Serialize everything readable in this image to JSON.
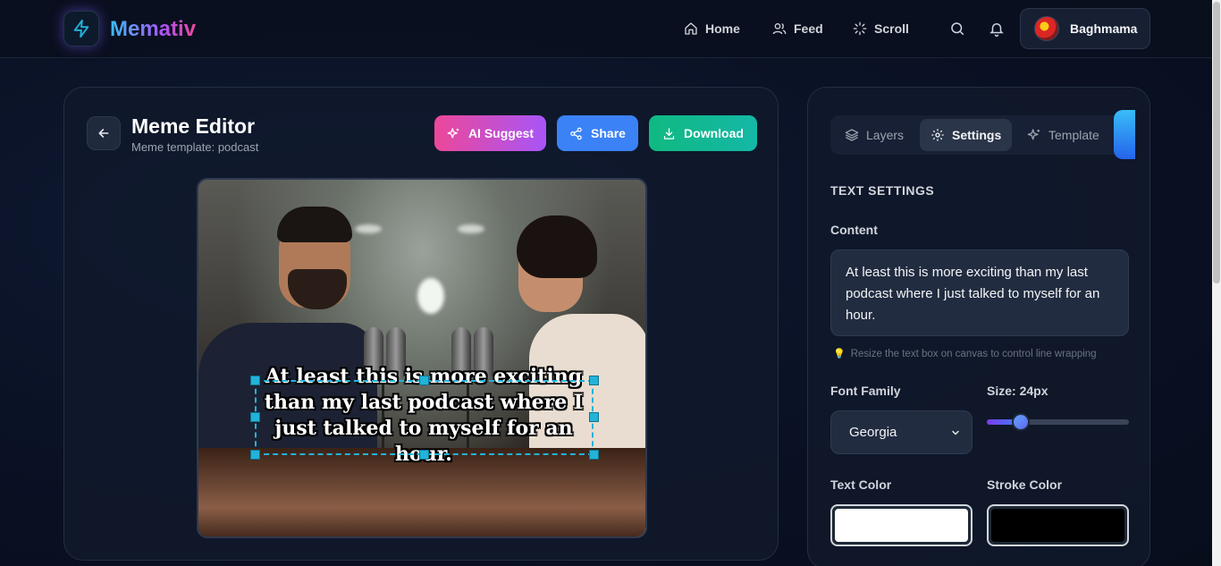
{
  "app": {
    "name": "Memativ",
    "nav": [
      {
        "label": "Home",
        "icon": "home-icon"
      },
      {
        "label": "Feed",
        "icon": "users-icon"
      },
      {
        "label": "Scroll",
        "icon": "loader-icon"
      }
    ],
    "user": {
      "name": "Baghmama"
    }
  },
  "editor": {
    "title": "Meme Editor",
    "subtitle": "Meme template: podcast",
    "buttons": {
      "ai_suggest": "AI Suggest",
      "share": "Share",
      "download": "Download"
    },
    "canvas_text": "At least this is more exciting than my last podcast where I just talked to myself for an hour."
  },
  "sidebar": {
    "tabs": [
      {
        "label": "Layers",
        "icon": "layers-icon",
        "active": false
      },
      {
        "label": "Settings",
        "icon": "gear-icon",
        "active": true
      },
      {
        "label": "Template",
        "icon": "sparkles-icon",
        "active": false
      }
    ],
    "section_title": "TEXT SETTINGS",
    "content_label": "Content",
    "content_value": "At least this is more exciting than my last podcast where I just talked to myself for an hour.",
    "hint": "Resize the text box on canvas to control line wrapping",
    "font_family_label": "Font Family",
    "font_family_value": "Georgia",
    "size_label": "Size: 24px",
    "size_slider_fraction": 0.24,
    "text_color_label": "Text Color",
    "text_color": "#ffffff",
    "stroke_color_label": "Stroke Color",
    "stroke_color": "#000000"
  },
  "colors": {
    "accent_blue": "#3b82f6",
    "accent_pink": "#ec4899",
    "accent_purple": "#a855f7",
    "accent_green": "#10b981",
    "selection": "#22b3d9"
  }
}
